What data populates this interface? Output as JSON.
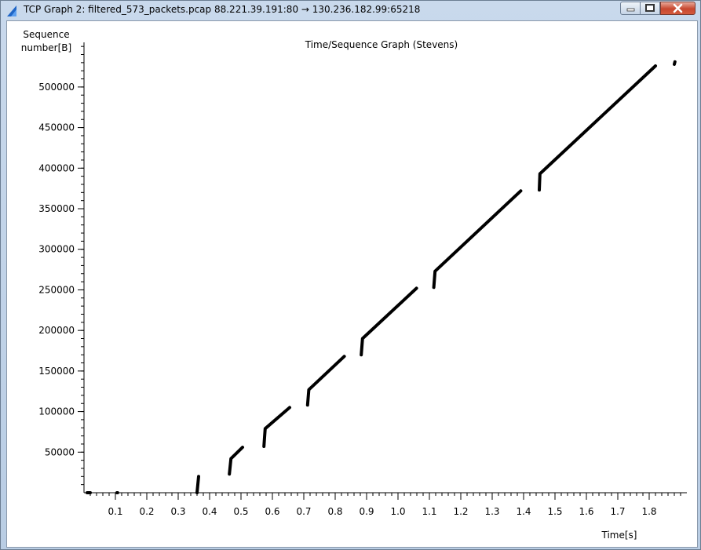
{
  "window": {
    "title": "TCP Graph 2: filtered_573_packets.pcap 88.221.39.191:80 → 130.236.182.99:65218",
    "controls": {
      "minimize": "minimize-icon",
      "maximize": "maximize-icon",
      "close": "close-icon"
    }
  },
  "chart_data": {
    "type": "scatter",
    "title": "Time/Sequence Graph (Stevens)",
    "ylabel_line1": "Sequence",
    "ylabel_line2": "number[B]",
    "xlabel": "Time[s]",
    "xlim": [
      0.0,
      1.92
    ],
    "ylim": [
      0,
      555000
    ],
    "x_ticks": [
      0.1,
      0.2,
      0.3,
      0.4,
      0.5,
      0.6,
      0.7,
      0.8,
      0.9,
      1.0,
      1.1,
      1.2,
      1.3,
      1.4,
      1.5,
      1.6,
      1.7,
      1.8
    ],
    "x_tick_labels": [
      "0.1",
      "0.2",
      "0.3",
      "0.4",
      "0.5",
      "0.6",
      "0.7",
      "0.8",
      "0.9",
      "1.0",
      "1.1",
      "1.2",
      "1.3",
      "1.4",
      "1.5",
      "1.6",
      "1.7",
      "1.8"
    ],
    "y_ticks": [
      50000,
      100000,
      150000,
      200000,
      250000,
      300000,
      350000,
      400000,
      450000,
      500000
    ],
    "y_tick_labels": [
      "50000",
      "100000",
      "150000",
      "200000",
      "250000",
      "300000",
      "350000",
      "400000",
      "450000",
      "500000"
    ],
    "series_color": "#000000",
    "segments": [
      [
        [
          0.01,
          0
        ],
        [
          0.02,
          0
        ]
      ],
      [
        [
          0.105,
          0
        ],
        [
          0.107,
          0
        ]
      ],
      [
        [
          0.36,
          0
        ],
        [
          0.365,
          20000
        ]
      ],
      [
        [
          0.463,
          23000
        ],
        [
          0.468,
          42000
        ],
        [
          0.505,
          56000
        ]
      ],
      [
        [
          0.573,
          57000
        ],
        [
          0.577,
          79000
        ],
        [
          0.655,
          105000
        ]
      ],
      [
        [
          0.712,
          108000
        ],
        [
          0.716,
          127000
        ],
        [
          0.829,
          168000
        ]
      ],
      [
        [
          0.883,
          170000
        ],
        [
          0.887,
          190000
        ],
        [
          1.059,
          252000
        ]
      ],
      [
        [
          1.114,
          253000
        ],
        [
          1.118,
          273000
        ],
        [
          1.391,
          372000
        ]
      ],
      [
        [
          1.45,
          373000
        ],
        [
          1.452,
          393000
        ],
        [
          1.82,
          526000
        ]
      ],
      [
        [
          1.88,
          528000
        ],
        [
          1.882,
          531000
        ]
      ]
    ]
  }
}
